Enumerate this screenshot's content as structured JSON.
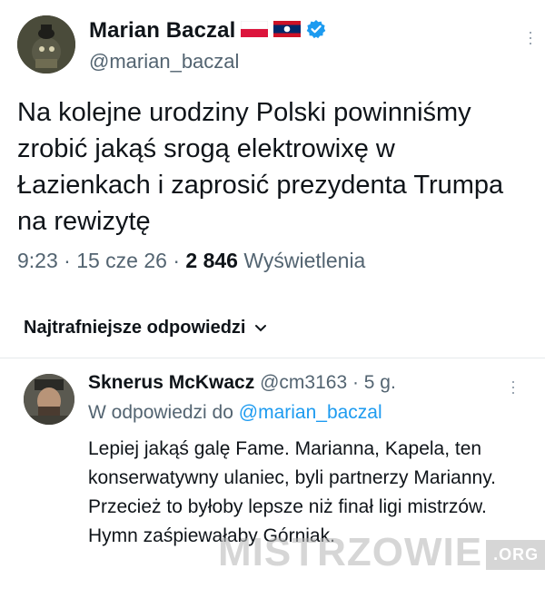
{
  "tweet": {
    "author_name": "Marian Baczal",
    "author_handle": "@marian_baczal",
    "text": "Na kolejne urodziny Polski powinniśmy zrobić jakąś srogą elektrowixę w Łazienkach i zaprosić prezydenta Trumpa na rewizytę",
    "time": "9:23 · 15 cze 26 ·",
    "views_count": "2 846",
    "views_label": "Wyświetlenia"
  },
  "replies_header": {
    "sort_label": "Najtrafniejsze odpowiedzi"
  },
  "reply": {
    "author_name": "Sknerus McKwacz",
    "author_handle": "@cm3163",
    "age": "· 5 g.",
    "in_reply_to_label": "W odpowiedzi do",
    "in_reply_to_handle": "@marian_baczal",
    "text": "Lepiej jakąś galę Fame. Marianna, Kapela, ten konserwatywny ulaniec, byli partnerzy Marianny. Przecież to byłoby lepsze niż finał ligi mistrzów. Hymn zaśpiewałaby Górniak."
  },
  "watermark": {
    "main": "MISTRZOWIE",
    "suffix": ".ORG"
  },
  "colors": {
    "text": "#0f1419",
    "secondary": "#536471",
    "link": "#1d9bf0",
    "verified": "#1d9bf0",
    "divider": "#e6e9ec"
  },
  "icons": {
    "flags": [
      "poland-flag-icon",
      "laos-flag-icon"
    ],
    "verified": "verified-badge-icon",
    "more": "more-vertical-icon",
    "sort": "chevron-down-icon"
  }
}
